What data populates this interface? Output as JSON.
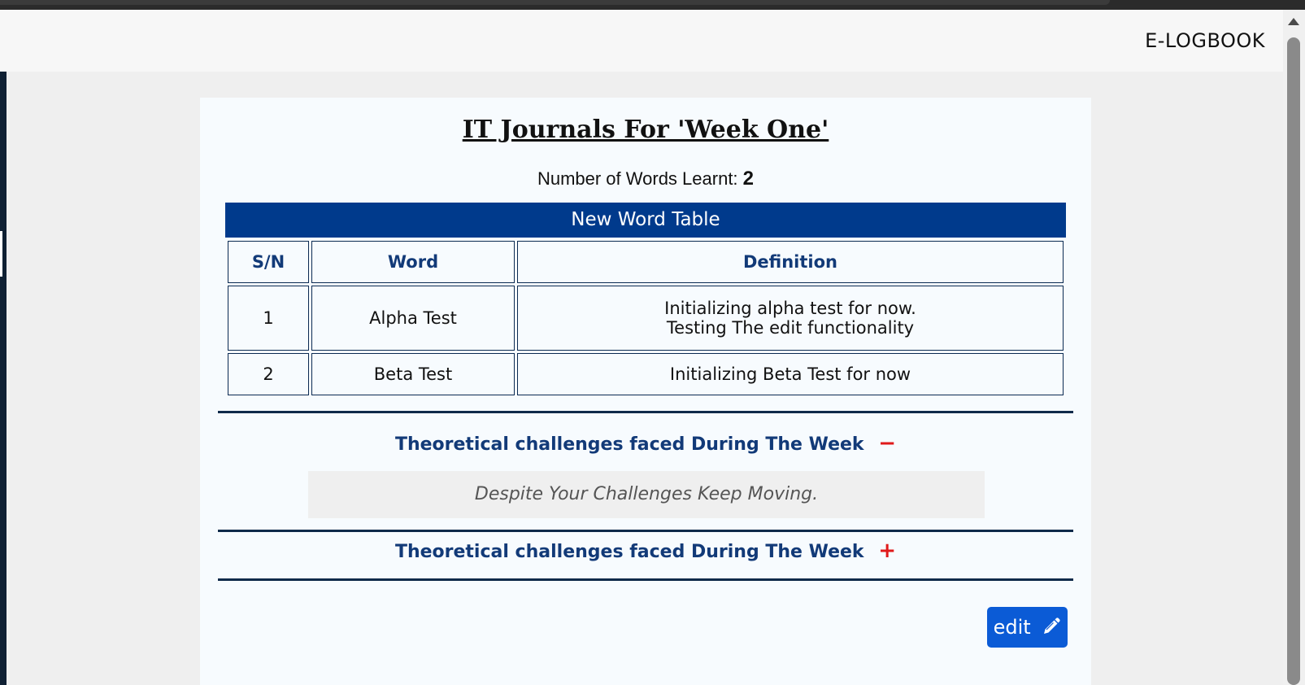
{
  "navbar": {
    "brand": "E-LOGBOOK"
  },
  "page": {
    "title": "IT Journals For 'Week One'",
    "words_count_label": "Number of Words Learnt:",
    "words_count": "2"
  },
  "table": {
    "caption": "New Word Table",
    "headers": [
      "S/N",
      "Word",
      "Definition"
    ],
    "rows": [
      {
        "sn": "1",
        "word": "Alpha Test",
        "definition_line1": "Initializing alpha test for now.",
        "definition_line2": "Testing The edit functionality"
      },
      {
        "sn": "2",
        "word": "Beta Test",
        "definition_line1": "Initializing Beta Test for now"
      }
    ]
  },
  "accordions": [
    {
      "title": "Theoretical challenges faced During The Week",
      "toggle": "−",
      "expanded": true,
      "content": "Despite Your Challenges Keep Moving."
    },
    {
      "title": "Theoretical challenges faced During The Week",
      "toggle": "+",
      "expanded": false
    }
  ],
  "actions": {
    "edit_label": "edit",
    "edit_icon": "pencil-icon"
  },
  "colors": {
    "primary": "#003a8c",
    "heading_blue": "#123a78",
    "toggle_red": "#e01a1a",
    "button_blue": "#0b5bd6"
  }
}
